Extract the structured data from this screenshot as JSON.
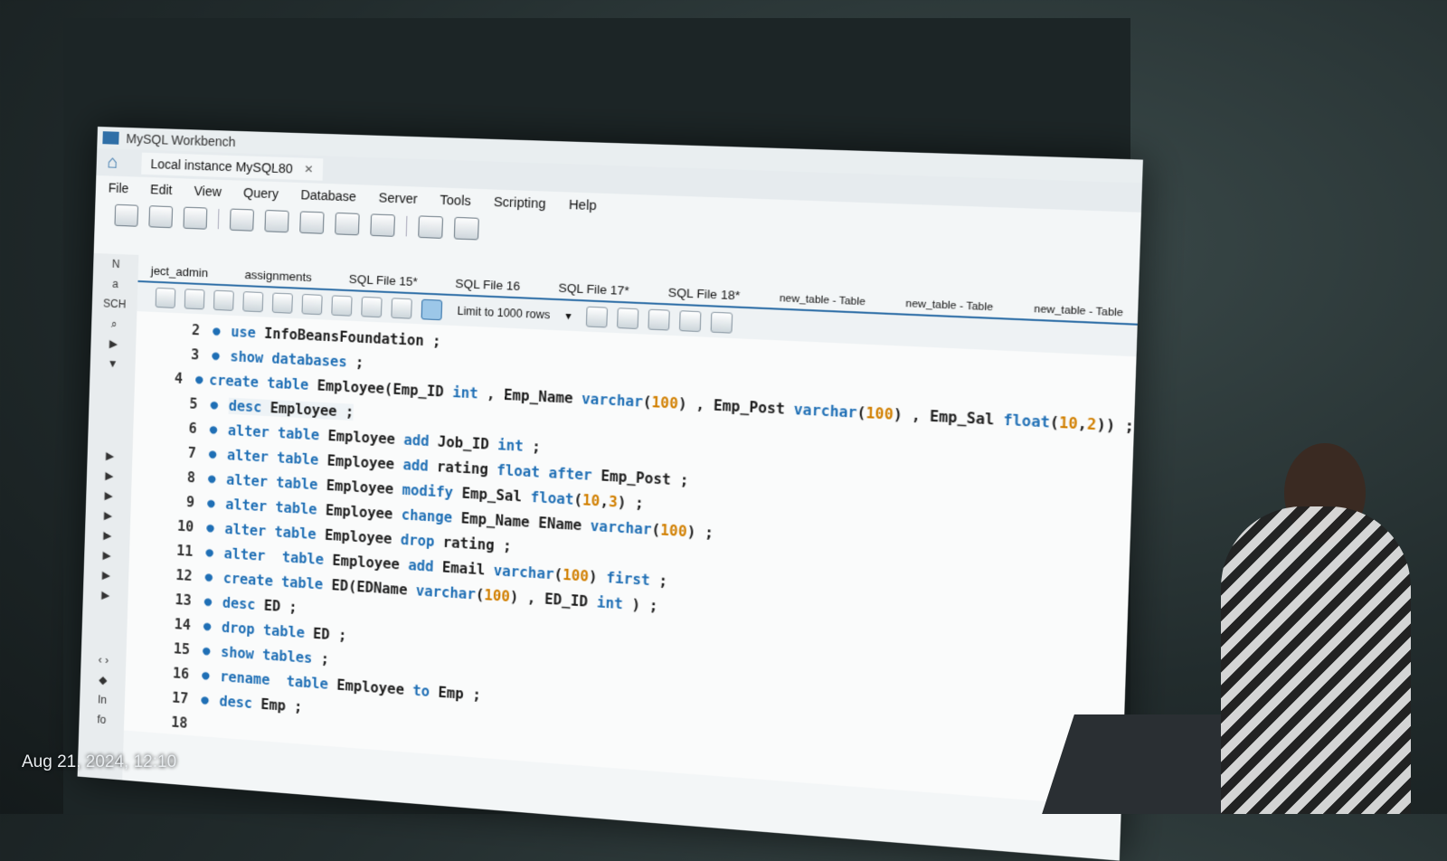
{
  "window": {
    "title": "MySQL Workbench"
  },
  "connection_tab": {
    "label": "Local instance MySQL80"
  },
  "menu": [
    "File",
    "Edit",
    "View",
    "Query",
    "Database",
    "Server",
    "Tools",
    "Scripting",
    "Help"
  ],
  "sidebar": {
    "labels": [
      "N",
      "a",
      "SCH",
      "In",
      "fo"
    ]
  },
  "file_tabs": [
    "ject_admin",
    "assignments",
    "SQL File 15*",
    "SQL File 16",
    "SQL File 17*",
    "SQL File 18*",
    "new_table - Table",
    "new_table - Table",
    "new_table - Table"
  ],
  "editor_toolbar": {
    "limit_label": "Limit to 1000 rows"
  },
  "code_lines": [
    {
      "n": "2",
      "segments": [
        {
          "t": "use ",
          "k": "kw"
        },
        {
          "t": "InfoBeansFoundation ;"
        }
      ]
    },
    {
      "n": "3",
      "segments": [
        {
          "t": "show databases ",
          "k": "kw"
        },
        {
          "t": ";"
        }
      ]
    },
    {
      "n": "4",
      "segments": [
        {
          "t": "create table ",
          "k": "kw"
        },
        {
          "t": "Employee(Emp_ID "
        },
        {
          "t": "int",
          "k": "kw"
        },
        {
          "t": " , Emp_Name "
        },
        {
          "t": "varchar",
          "k": "kw"
        },
        {
          "t": "("
        },
        {
          "t": "100",
          "k": "num"
        },
        {
          "t": ") , Emp_Post "
        },
        {
          "t": "varchar",
          "k": "kw"
        },
        {
          "t": "("
        },
        {
          "t": "100",
          "k": "num"
        },
        {
          "t": ") , Emp_Sal "
        },
        {
          "t": "float",
          "k": "kw"
        },
        {
          "t": "("
        },
        {
          "t": "10",
          "k": "num"
        },
        {
          "t": ","
        },
        {
          "t": "2",
          "k": "num"
        },
        {
          "t": ")) ;"
        }
      ]
    },
    {
      "n": "5",
      "segments": [
        {
          "t": "desc ",
          "k": "kw"
        },
        {
          "t": "Employee ;"
        }
      ],
      "current": true
    },
    {
      "n": "6",
      "segments": [
        {
          "t": "alter table ",
          "k": "kw"
        },
        {
          "t": "Employee "
        },
        {
          "t": "add ",
          "k": "kw"
        },
        {
          "t": "Job_ID "
        },
        {
          "t": "int",
          "k": "kw"
        },
        {
          "t": " ;"
        }
      ]
    },
    {
      "n": "7",
      "segments": [
        {
          "t": "alter table ",
          "k": "kw"
        },
        {
          "t": "Employee "
        },
        {
          "t": "add ",
          "k": "kw"
        },
        {
          "t": "rating "
        },
        {
          "t": "float after ",
          "k": "kw"
        },
        {
          "t": "Emp_Post ;"
        }
      ]
    },
    {
      "n": "8",
      "segments": [
        {
          "t": "alter table ",
          "k": "kw"
        },
        {
          "t": "Employee "
        },
        {
          "t": "modify ",
          "k": "kw"
        },
        {
          "t": "Emp_Sal "
        },
        {
          "t": "float",
          "k": "kw"
        },
        {
          "t": "("
        },
        {
          "t": "10",
          "k": "num"
        },
        {
          "t": ","
        },
        {
          "t": "3",
          "k": "num"
        },
        {
          "t": ") ;"
        }
      ]
    },
    {
      "n": "9",
      "segments": [
        {
          "t": "alter table ",
          "k": "kw"
        },
        {
          "t": "Employee "
        },
        {
          "t": "change ",
          "k": "kw"
        },
        {
          "t": "Emp_Name EName "
        },
        {
          "t": "varchar",
          "k": "kw"
        },
        {
          "t": "("
        },
        {
          "t": "100",
          "k": "num"
        },
        {
          "t": ") ;"
        }
      ]
    },
    {
      "n": "10",
      "segments": [
        {
          "t": "alter table ",
          "k": "kw"
        },
        {
          "t": "Employee "
        },
        {
          "t": "drop ",
          "k": "kw"
        },
        {
          "t": "rating ;"
        }
      ]
    },
    {
      "n": "11",
      "segments": [
        {
          "t": "alter  table ",
          "k": "kw"
        },
        {
          "t": "Employee "
        },
        {
          "t": "add ",
          "k": "kw"
        },
        {
          "t": "Email "
        },
        {
          "t": "varchar",
          "k": "kw"
        },
        {
          "t": "("
        },
        {
          "t": "100",
          "k": "num"
        },
        {
          "t": ") "
        },
        {
          "t": "first",
          "k": "kw"
        },
        {
          "t": " ;"
        }
      ]
    },
    {
      "n": "12",
      "segments": [
        {
          "t": "create table ",
          "k": "kw"
        },
        {
          "t": "ED(EDName "
        },
        {
          "t": "varchar",
          "k": "kw"
        },
        {
          "t": "("
        },
        {
          "t": "100",
          "k": "num"
        },
        {
          "t": ") , ED_ID "
        },
        {
          "t": "int",
          "k": "kw"
        },
        {
          "t": " ) ;"
        }
      ]
    },
    {
      "n": "13",
      "segments": [
        {
          "t": "desc ",
          "k": "kw"
        },
        {
          "t": "ED ;"
        }
      ]
    },
    {
      "n": "14",
      "segments": [
        {
          "t": "drop table ",
          "k": "kw"
        },
        {
          "t": "ED ;"
        }
      ]
    },
    {
      "n": "15",
      "segments": [
        {
          "t": "show tables ",
          "k": "kw"
        },
        {
          "t": ";"
        }
      ]
    },
    {
      "n": "16",
      "segments": [
        {
          "t": "rename  table ",
          "k": "kw"
        },
        {
          "t": "Employee "
        },
        {
          "t": "to ",
          "k": "kw"
        },
        {
          "t": "Emp ;"
        }
      ]
    },
    {
      "n": "17",
      "segments": [
        {
          "t": "desc ",
          "k": "kw"
        },
        {
          "t": "Emp ;"
        }
      ]
    },
    {
      "n": "18",
      "segments": []
    }
  ],
  "caption": "Aug 21, 2024, 12:10",
  "colors": {
    "keyword": "#1f6fb5",
    "number": "#d17f00",
    "accent": "#2f6fa7"
  },
  "icons": [
    "home-icon",
    "close-icon",
    "sql-open-icon",
    "sql-save-icon",
    "info-icon",
    "db-icon",
    "execute-icon",
    "search-icon",
    "stop-icon",
    "commit-icon",
    "rollback-icon",
    "bookmark-icon",
    "beautify-icon",
    "find-icon",
    "invisible-chars-icon",
    "wrap-icon",
    "chevron-down-icon"
  ]
}
